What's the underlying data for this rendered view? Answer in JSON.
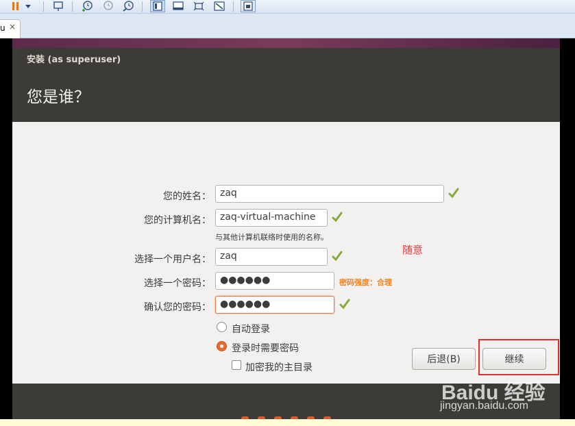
{
  "toolbar": {
    "icons": [
      "pause-icon",
      "dropdown-arrow-icon",
      "send-keys-icon",
      "snapshot-icon",
      "revert-snapshot-icon",
      "snapshot-manager-icon",
      "console-view-icon",
      "quick-switch-icon",
      "full-screen-icon",
      "unity-icon",
      "thumbnail-icon"
    ]
  },
  "tab": {
    "label": "u",
    "close": "×"
  },
  "installer": {
    "window_title": "安装 (as superuser)",
    "page_title": "您是谁？",
    "fields": {
      "name_label": "您的姓名：",
      "name_value": "zaq",
      "computer_label": "您的计算机名：",
      "computer_value": "zaq-virtual-machine",
      "computer_hint": "与其他计算机联络时使用的名称。",
      "username_label": "选择一个用户名：",
      "username_value": "zaq",
      "password_label": "选择一个密码：",
      "password_value": "●●●●●●",
      "password_strength": "密码强度：合理",
      "confirm_label": "确认您的密码：",
      "confirm_value": "●●●●●●"
    },
    "options": {
      "auto_login": "自动登录",
      "require_password": "登录时需要密码",
      "encrypt_home": "加密我的主目录"
    },
    "buttons": {
      "back": "后退(B)",
      "continue": "继续"
    }
  },
  "annotation": {
    "note": "随意"
  },
  "watermark": {
    "brand": "Baidu 经验",
    "url": "jingyan.baidu.com"
  },
  "colors": {
    "accent": "#e96b33",
    "strength": "#f0841e",
    "annotation": "#e23c3c",
    "header": "#3c3b37"
  }
}
